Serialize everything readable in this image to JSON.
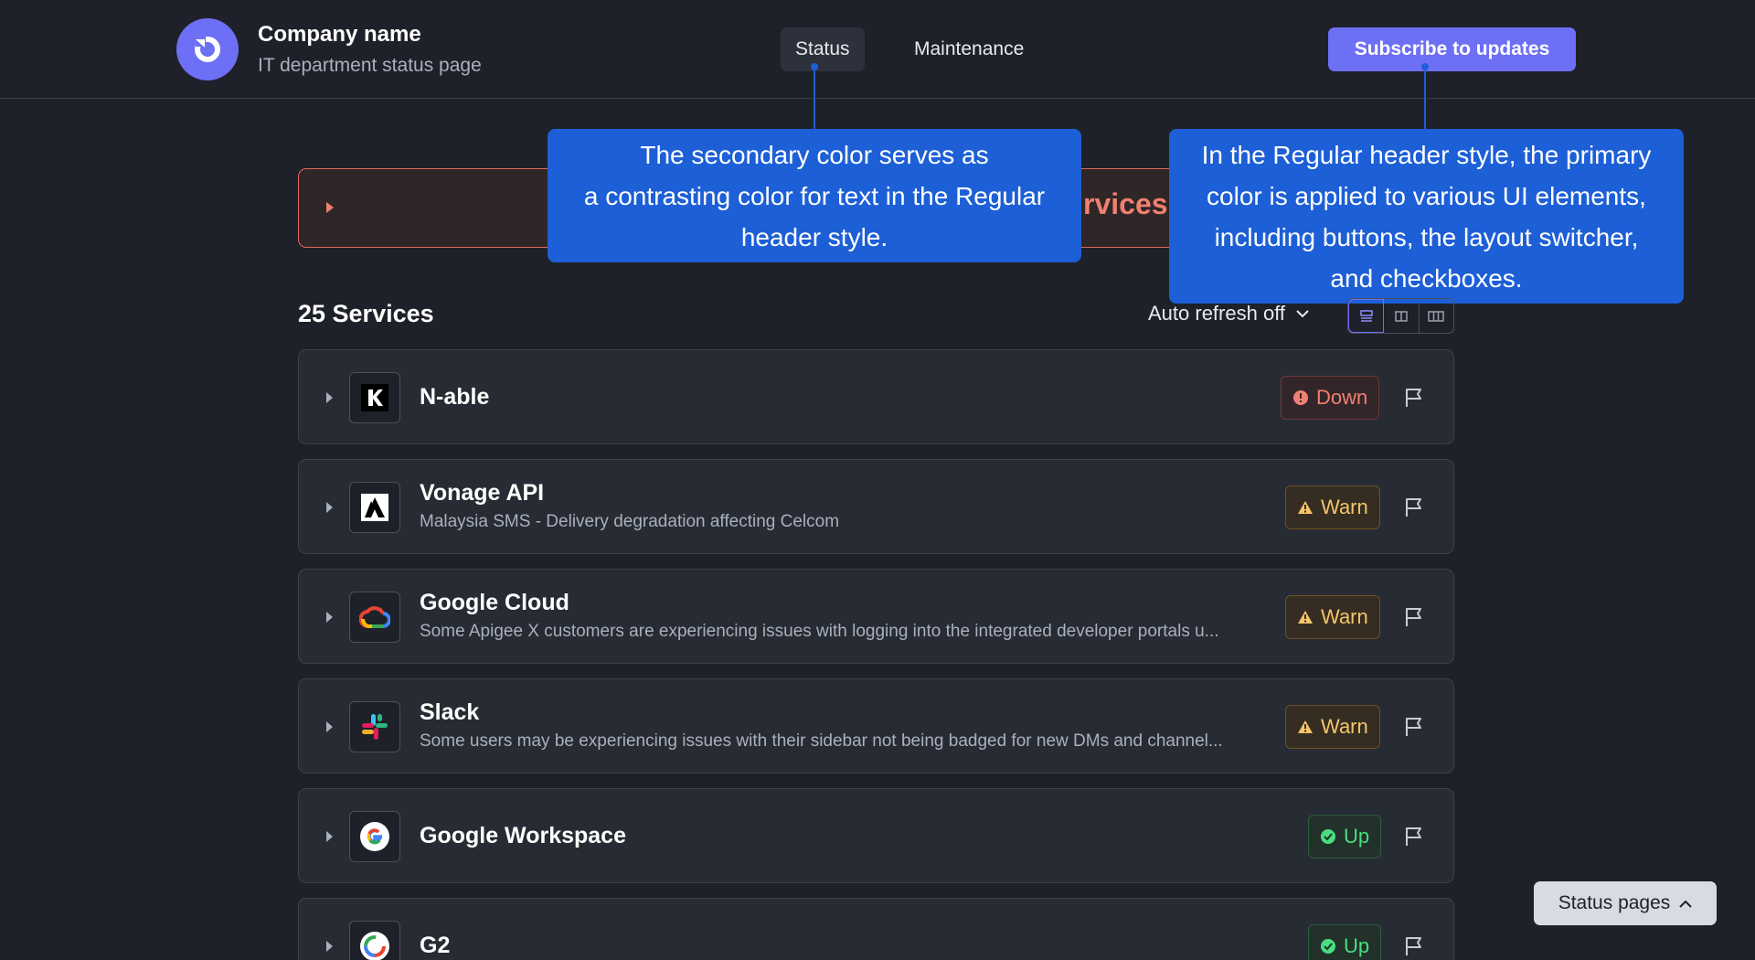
{
  "header": {
    "company_name": "Company name",
    "company_subtitle": "IT department status page",
    "nav": [
      {
        "label": "Status",
        "active": true
      },
      {
        "label": "Maintenance",
        "active": false
      }
    ],
    "subscribe_label": "Subscribe to updates"
  },
  "banner": {
    "text": "rvices"
  },
  "tooltips": {
    "secondary_color_lines": [
      "The secondary color serves as",
      "a contrasting color for text in the Regular",
      "header style."
    ],
    "primary_color_lines": [
      "In the Regular header style, the primary",
      "color is applied to various UI elements,",
      "including buttons, the layout switcher,",
      "and checkboxes."
    ]
  },
  "services_header": {
    "title": "25 Services",
    "auto_refresh": "Auto refresh off"
  },
  "services": [
    {
      "name": "N-able",
      "desc": "",
      "status": "Down",
      "status_type": "down",
      "logo": "n-able-logo"
    },
    {
      "name": "Vonage API",
      "desc": "Malaysia SMS - Delivery degradation affecting Celcom",
      "status": "Warn",
      "status_type": "warn",
      "logo": "vonage-logo"
    },
    {
      "name": "Google Cloud",
      "desc": "Some Apigee X customers are experiencing issues with logging into the integrated developer portals u...",
      "status": "Warn",
      "status_type": "warn",
      "logo": "google-cloud-logo"
    },
    {
      "name": "Slack",
      "desc": "Some users may be experiencing issues with their sidebar not being badged for new DMs and channel...",
      "status": "Warn",
      "status_type": "warn",
      "logo": "slack-logo"
    },
    {
      "name": "Google Workspace",
      "desc": "",
      "status": "Up",
      "status_type": "up",
      "logo": "google-logo"
    },
    {
      "name": "G2",
      "desc": "",
      "status": "Up",
      "status_type": "up",
      "logo": "g2-logo"
    }
  ],
  "status_pages_label": "Status pages",
  "colors": {
    "primary": "#6d6ff5",
    "background": "#1e2129",
    "card": "#272b33",
    "tooltip": "#1d5fd6",
    "down": "#f08070",
    "warn": "#f5c56a",
    "up": "#4ade80"
  }
}
